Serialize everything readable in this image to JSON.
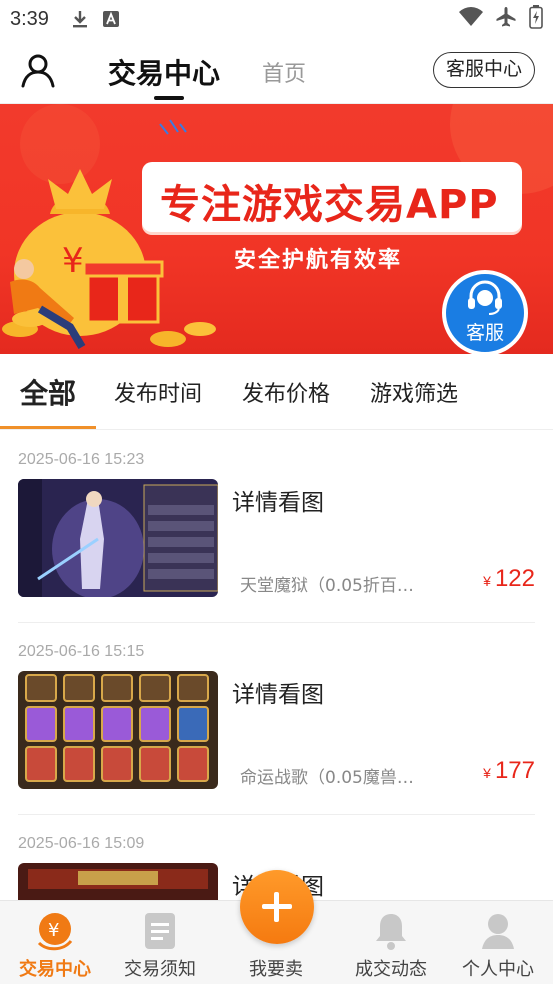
{
  "status_bar": {
    "time": "3:39"
  },
  "header": {
    "title": "交易中心",
    "home_tab": "首页",
    "service_button": "客服中心"
  },
  "banner": {
    "headline": "专注游戏交易APP",
    "subline": "安全护航有效率",
    "service_badge": "客服"
  },
  "filter_tabs": [
    {
      "label": "全部",
      "active": true
    },
    {
      "label": "发布时间",
      "active": false
    },
    {
      "label": "发布价格",
      "active": false
    },
    {
      "label": "游戏筛选",
      "active": false
    }
  ],
  "listings": [
    {
      "date": "2025-06-16 15:23",
      "title": "详情看图",
      "description": "天堂魔狱（0.05折百…",
      "currency": "¥",
      "price": "122"
    },
    {
      "date": "2025-06-16 15:15",
      "title": "详情看图",
      "description": "命运战歌（0.05魔兽…",
      "currency": "¥",
      "price": "177"
    },
    {
      "date": "2025-06-16 15:09",
      "title": "详情看图",
      "description": "",
      "currency": "",
      "price": ""
    }
  ],
  "bottom_nav": [
    {
      "label": "交易中心",
      "icon": "yen-bag-icon",
      "active": true
    },
    {
      "label": "交易须知",
      "icon": "document-icon",
      "active": false
    },
    {
      "label": "我要卖",
      "icon": "plus-icon",
      "active": false
    },
    {
      "label": "成交动态",
      "icon": "bell-icon",
      "active": false
    },
    {
      "label": "个人中心",
      "icon": "person-icon",
      "active": false
    }
  ],
  "colors": {
    "accent": "#f07a14",
    "price": "#e8261a",
    "banner": "#f13526",
    "service_blue": "#1a7de3"
  }
}
